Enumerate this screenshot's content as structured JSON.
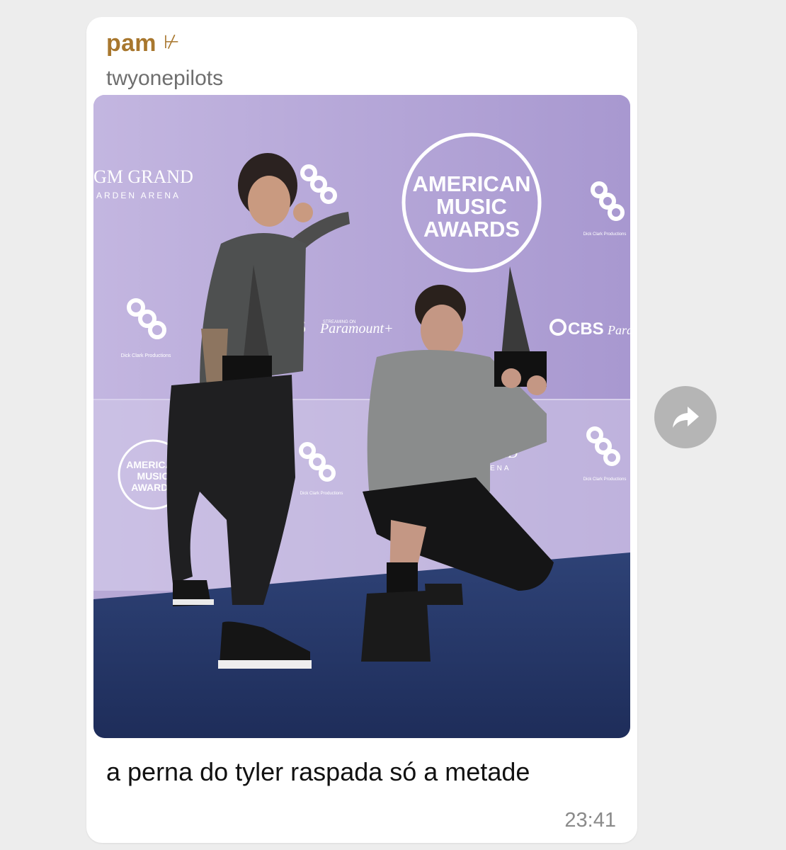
{
  "message": {
    "sender_name": "pam",
    "sender_badge": "⊬",
    "forwarded_from": "twyonepilots",
    "caption": "a perna do tyler raspada só a metade",
    "time": "23:41"
  },
  "photo": {
    "backdrop_texts": {
      "ama_logo_big": [
        "AMERICAN",
        "MUSIC",
        "AWARDS"
      ],
      "ama_logo_small": [
        "AMERICAN",
        "MUSIC",
        "AWARDS"
      ],
      "mgm_line1": "GM GRAND",
      "mgm_line2": "ARDEN ARENA",
      "mgm2_line1": "AND",
      "mgm2_line2": "ENA",
      "dcp_caption": "Dick Clark Productions",
      "cbs_1": "BS",
      "cbs_2": "CBS",
      "paramount": "Paramount+",
      "paramount_2": "Para",
      "streaming_on": "STREAMING ON",
      "trophy_plate": "AMERICAN MUSIC AWARDS"
    }
  },
  "icons": {
    "forward": "forward-arrow-icon"
  },
  "colors": {
    "sender": "#a8772e",
    "backdrop": "#b7a9d6",
    "carpet": "#26386a",
    "forward_button": "#b5b5b5"
  }
}
